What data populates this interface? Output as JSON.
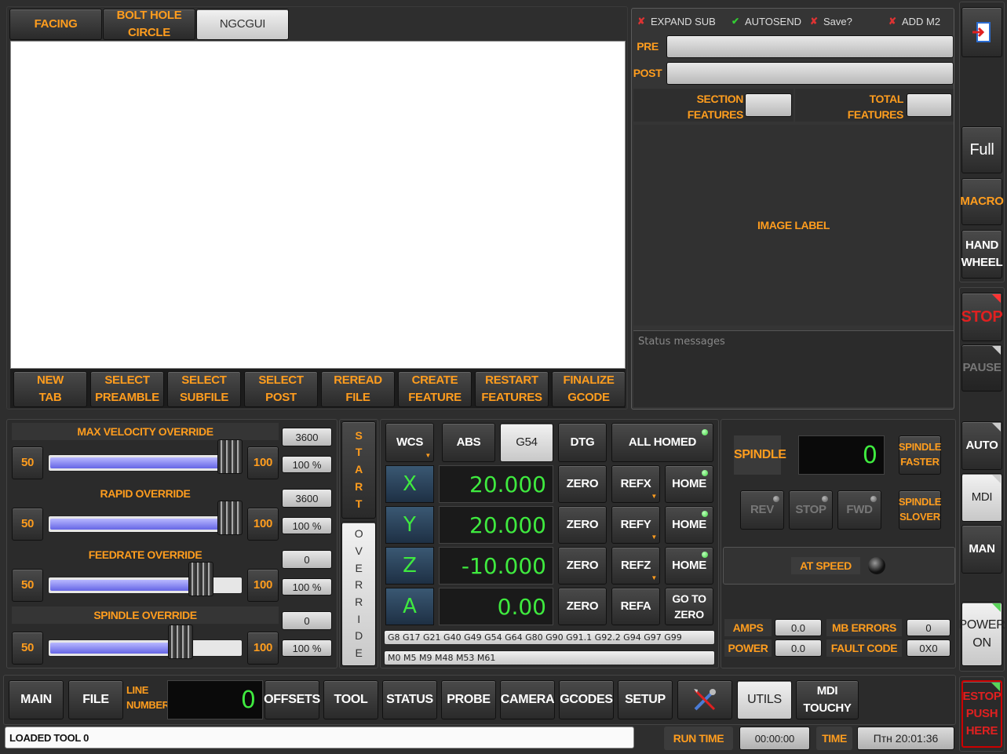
{
  "tabs": [
    {
      "label": "FACING",
      "active": false
    },
    {
      "label": "BOLT HOLE CIRCLE",
      "active": false
    },
    {
      "label": "NGCGUI",
      "active": true
    }
  ],
  "ngc_buttons": [
    "NEW\nTAB",
    "SELECT\nPREAMBLE",
    "SELECT\nSUBFILE",
    "SELECT\nPOST",
    "REREAD\nFILE",
    "CREATE\nFEATURE",
    "RESTART\nFEATURES",
    "FINALIZE\nGCODE"
  ],
  "options": {
    "expand_sub": "EXPAND SUB",
    "autosend": "AUTOSEND",
    "save": "Save?",
    "add_m2": "ADD M2"
  },
  "pre_label": "PRE",
  "post_label": "POST",
  "section_features": "SECTION\nFEATURES",
  "total_features": "TOTAL\nFEATURES",
  "image_label": "IMAGE LABEL",
  "status_placeholder": "Status messages",
  "right_column": {
    "full": "Full",
    "macro": "MACRO",
    "handwheel": "HAND\nWHEEL",
    "stop": "STOP",
    "pause": "PAUSE",
    "auto": "AUTO",
    "mdi": "MDI",
    "man": "MAN",
    "power": "POWER\nON",
    "estop": "ESTOP\nPUSH\nHERE"
  },
  "overrides": [
    {
      "title": "MAX VELOCITY OVERRIDE",
      "min": "50",
      "max": "100",
      "value": "3600",
      "pct": "100 %",
      "level": 1.0
    },
    {
      "title": "RAPID OVERRIDE",
      "min": "50",
      "max": "100",
      "value": "3600",
      "pct": "100 %",
      "level": 1.0
    },
    {
      "title": "FEEDRATE OVERRIDE",
      "min": "50",
      "max": "100",
      "value": "0",
      "pct": "100 %",
      "level": 0.75
    },
    {
      "title": "SPINDLE OVERRIDE",
      "min": "50",
      "max": "100",
      "value": "0",
      "pct": "100 %",
      "level": 0.6
    }
  ],
  "start_override": {
    "start": "START",
    "override": "OVERRIDE"
  },
  "dro_header": {
    "wcs": "WCS",
    "abs": "ABS",
    "g54": "G54",
    "dtg": "DTG",
    "all_homed": "ALL HOMED"
  },
  "axes": [
    {
      "name": "X",
      "value": "20.000",
      "zero": "ZERO",
      "ref": "REFX",
      "home": "HOME"
    },
    {
      "name": "Y",
      "value": "20.000",
      "zero": "ZERO",
      "ref": "REFY",
      "home": "HOME"
    },
    {
      "name": "Z",
      "value": "-10.000",
      "zero": "ZERO",
      "ref": "REFZ",
      "home": "HOME"
    },
    {
      "name": "A",
      "value": "0.00",
      "zero": "ZERO",
      "ref": "REFA",
      "home": "GO TO\nZERO"
    }
  ],
  "gcodes": "G8 G17 G21 G40 G49 G54 G64 G80 G90 G91.1 G92.2 G94 G97 G99",
  "mcodes": "M0 M5 M9 M48 M53 M61",
  "spindle": {
    "label": "SPINDLE",
    "rpm": "0",
    "faster": "SPINDLE\nFASTER",
    "slower": "SPINDLE\nSLOVER",
    "rev": "REV",
    "stop": "STOP",
    "fwd": "FWD",
    "at_speed": "AT SPEED",
    "amps_label": "AMPS",
    "amps": "0.0",
    "power_label": "POWER",
    "power": "0.0",
    "mb_errors_label": "MB ERRORS",
    "mb_errors": "0",
    "fault_label": "FAULT CODE",
    "fault": "0X0"
  },
  "bottom_nav": {
    "main": "MAIN",
    "file": "FILE",
    "line_number_label": "LINE\nNUMBER",
    "line_number": "0",
    "offsets": "OFFSETS",
    "tool": "TOOL",
    "status": "STATUS",
    "probe": "PROBE",
    "camera": "CAMERA",
    "gcodes": "GCODES",
    "setup": "SETUP",
    "utils": "UTILS",
    "mdi_touchy": "MDI\nTOUCHY"
  },
  "status_bar": {
    "message": "LOADED TOOL 0",
    "run_time_label": "RUN TIME",
    "run_time": "00:00:00",
    "time_label": "TIME",
    "time": "Птн 20:01:36"
  }
}
